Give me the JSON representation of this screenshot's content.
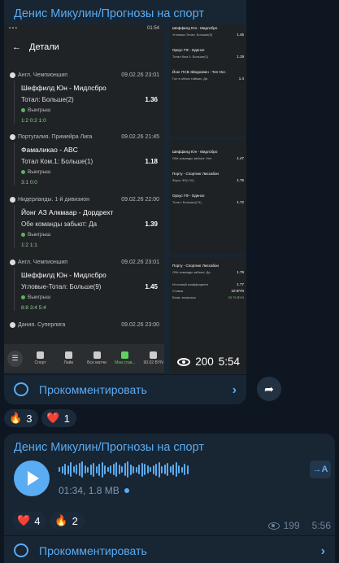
{
  "post1": {
    "sender": "Денис Микулин/Прогнозы на спорт",
    "comment_label": "Прокомментировать",
    "views": "200",
    "time": "5:54",
    "reactions": [
      {
        "emoji": "🔥",
        "count": "3"
      },
      {
        "emoji": "❤️",
        "count": "1"
      }
    ],
    "screenshot": {
      "status_time": "01:54",
      "title": "Детали",
      "bets": [
        {
          "league": "Англ. Чемпионшип",
          "date": "09.02.26 23:01",
          "match": "Шеффилд Юн - Мидлсбро",
          "market": "Тотал: Больше(2)",
          "odd": "1.36",
          "result": "Выигрыш",
          "score": "1:2  0:2  1:0"
        },
        {
          "league": "Португалия. Примейра Лига",
          "date": "09.02.26 21:45",
          "match": "Фамаликао - ABC",
          "market": "Тотал Ком.1: Больше(1)",
          "odd": "1.18",
          "result": "Выигрыш",
          "score": "3:1  0:0"
        },
        {
          "league": "Нидерланды. 1-й дивизион",
          "date": "09.02.26 22:00",
          "match": "Йонг АЗ Алкмаар - Дордрехт",
          "market": "Обе команды забьют: Да",
          "odd": "1.39",
          "result": "Выигрыш",
          "score": "1:2  1:1"
        },
        {
          "league": "Англ. Чемпионшип",
          "date": "09.02.26 23:01",
          "match": "Шеффилд Юн - Мидлсбро",
          "market": "Угловые-Тотал: Больше(9)",
          "odd": "1.45",
          "result": "Выигрыш",
          "score": "8:8  3:4  5:4"
        },
        {
          "league": "Дания. Суперлига",
          "date": "09.02.26 23:00",
          "match": "",
          "market": "",
          "odd": "",
          "result": "",
          "score": ""
        }
      ],
      "nav": [
        "Спорт",
        "Лайв",
        "Все матчи",
        "Мои став...",
        "90.02 BYN"
      ]
    },
    "side_shots": {
      "top": [
        {
          "match": "Шеффилд Юн - Мидлсбро",
          "market": "Угловые-Тотал: Больше(9)",
          "odd": "1.45"
        },
        {
          "match": "Орхус ГФ - Оденсе",
          "market": "Тотал Ком.1: Больше(1)",
          "odd": "1.19"
        },
        {
          "match": "Йонг ПСВ Эйндховен - Тел Осс",
          "market": "Гол в обоих таймах: Да",
          "odd": "1.4"
        }
      ],
      "middle": [
        {
          "match": "Шеффилд Юн - Мидлсбро",
          "market": "Обе команды забьют: Нет",
          "odd": "1.47"
        },
        {
          "match": "Портy - Спортинг Лиссабон",
          "market": "Фора: Ф2(+10)",
          "odd": "1.75"
        },
        {
          "match": "Орхус ГФ - Оденсе",
          "market": "Тотал: Больше(2.5)",
          "odd": "1.72"
        }
      ],
      "bottom": {
        "match": "Портy - Спортинг Лиссабон",
        "market": "Обе команды забьют: Да",
        "odd": "1.79",
        "summary": [
          {
            "label": "Итоговый коэффициент",
            "value": "1.77"
          },
          {
            "label": "Ставка",
            "value": "10 BYN"
          },
          {
            "label": "Возм. выигрыш",
            "value": "33.79 BYN"
          }
        ]
      }
    }
  },
  "post2": {
    "sender": "Денис Микулин/Прогнозы на спорт",
    "duration": "01:34, 1.8 MB",
    "transcribe_label": "→A",
    "comment_label": "Прокомментировать",
    "views": "199",
    "time": "5:56",
    "reactions": [
      {
        "emoji": "❤️",
        "count": "4"
      },
      {
        "emoji": "🔥",
        "count": "2"
      }
    ]
  },
  "colors": {
    "accent": "#5aacf3",
    "bubble": "#182533",
    "background": "#0e1621",
    "win": "#5eb25e"
  }
}
